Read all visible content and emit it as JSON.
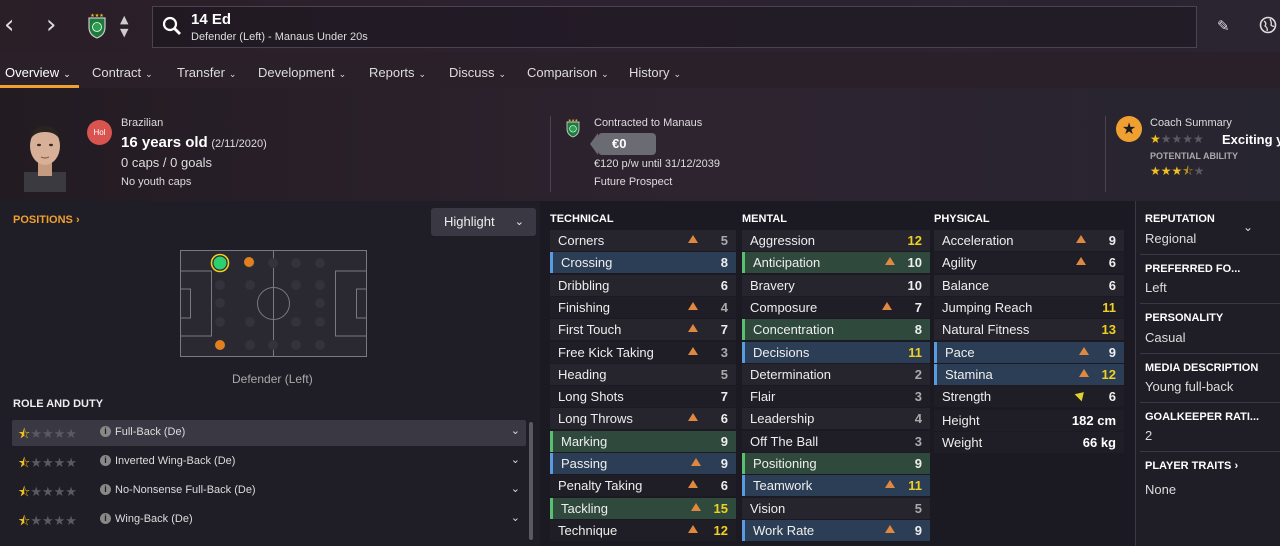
{
  "player": {
    "title": "14 Ed",
    "subtitle": "Defender (Left) - Manaus Under 20s",
    "nationality": "Brazilian",
    "age": "16 years old",
    "dob": "(2/11/2020)",
    "caps": "0 caps / 0 goals",
    "youth_caps": "No youth caps",
    "badge": "Hol"
  },
  "tabs": [
    {
      "label": "Overview"
    },
    {
      "label": "Contract"
    },
    {
      "label": "Transfer"
    },
    {
      "label": "Development"
    },
    {
      "label": "Reports"
    },
    {
      "label": "Discuss"
    },
    {
      "label": "Comparison"
    },
    {
      "label": "History"
    }
  ],
  "contract": {
    "title": "Contracted to Manaus",
    "value": "€0",
    "wage": "€120 p/w until 31/12/2039",
    "status": "Future Prospect"
  },
  "coach": {
    "title": "Coach Summary",
    "headline": "Exciting y",
    "potential_label": "POTENTIAL ABILITY",
    "current_stars": 0.5,
    "potential_stars": 3.5
  },
  "positions": {
    "title": "POSITIONS",
    "highlight": "Highlight",
    "label": "Defender (Left)"
  },
  "roles": {
    "title": "ROLE AND DUTY",
    "items": [
      {
        "label": "Full-Back (De)",
        "stars": 0.5
      },
      {
        "label": "Inverted Wing-Back (De)",
        "stars": 0.5
      },
      {
        "label": "No-Nonsense Full-Back (De)",
        "stars": 0.5
      },
      {
        "label": "Wing-Back (De)",
        "stars": 0.5
      }
    ]
  },
  "technical": {
    "title": "TECHNICAL",
    "rows": [
      {
        "label": "Corners",
        "value": "5"
      },
      {
        "label": "Crossing",
        "value": "8"
      },
      {
        "label": "Dribbling",
        "value": "6"
      },
      {
        "label": "Finishing",
        "value": "4"
      },
      {
        "label": "First Touch",
        "value": "7"
      },
      {
        "label": "Free Kick Taking",
        "value": "3"
      },
      {
        "label": "Heading",
        "value": "5"
      },
      {
        "label": "Long Shots",
        "value": "7"
      },
      {
        "label": "Long Throws",
        "value": "6"
      },
      {
        "label": "Marking",
        "value": "9"
      },
      {
        "label": "Passing",
        "value": "9"
      },
      {
        "label": "Penalty Taking",
        "value": "6"
      },
      {
        "label": "Tackling",
        "value": "15"
      },
      {
        "label": "Technique",
        "value": "12"
      }
    ]
  },
  "mental": {
    "title": "MENTAL",
    "rows": [
      {
        "label": "Aggression",
        "value": "12"
      },
      {
        "label": "Anticipation",
        "value": "10"
      },
      {
        "label": "Bravery",
        "value": "10"
      },
      {
        "label": "Composure",
        "value": "7"
      },
      {
        "label": "Concentration",
        "value": "8"
      },
      {
        "label": "Decisions",
        "value": "11"
      },
      {
        "label": "Determination",
        "value": "2"
      },
      {
        "label": "Flair",
        "value": "3"
      },
      {
        "label": "Leadership",
        "value": "4"
      },
      {
        "label": "Off The Ball",
        "value": "3"
      },
      {
        "label": "Positioning",
        "value": "9"
      },
      {
        "label": "Teamwork",
        "value": "11"
      },
      {
        "label": "Vision",
        "value": "5"
      },
      {
        "label": "Work Rate",
        "value": "9"
      }
    ]
  },
  "physical": {
    "title": "PHYSICAL",
    "rows": [
      {
        "label": "Acceleration",
        "value": "9"
      },
      {
        "label": "Agility",
        "value": "6"
      },
      {
        "label": "Balance",
        "value": "6"
      },
      {
        "label": "Jumping Reach",
        "value": "11"
      },
      {
        "label": "Natural Fitness",
        "value": "13"
      },
      {
        "label": "Pace",
        "value": "9"
      },
      {
        "label": "Stamina",
        "value": "12"
      },
      {
        "label": "Strength",
        "value": "6"
      }
    ],
    "height_label": "Height",
    "height": "182 cm",
    "weight_label": "Weight",
    "weight": "66 kg"
  },
  "info": {
    "reputation_h": "REPUTATION",
    "reputation": "Regional",
    "foot_h": "PREFERRED FO...",
    "foot": "Left",
    "personality_h": "PERSONALITY",
    "personality": "Casual",
    "media_h": "MEDIA DESCRIPTION",
    "media": "Young full-back",
    "gk_h": "GOALKEEPER RATI...",
    "gk": "2",
    "traits_h": "PLAYER TRAITS",
    "traits": "None"
  },
  "colors": {
    "accent": "#f0a030",
    "highlight_value": "#f0d020",
    "blue_row": "#2c3e55",
    "green_row": "#2f4a3c"
  }
}
